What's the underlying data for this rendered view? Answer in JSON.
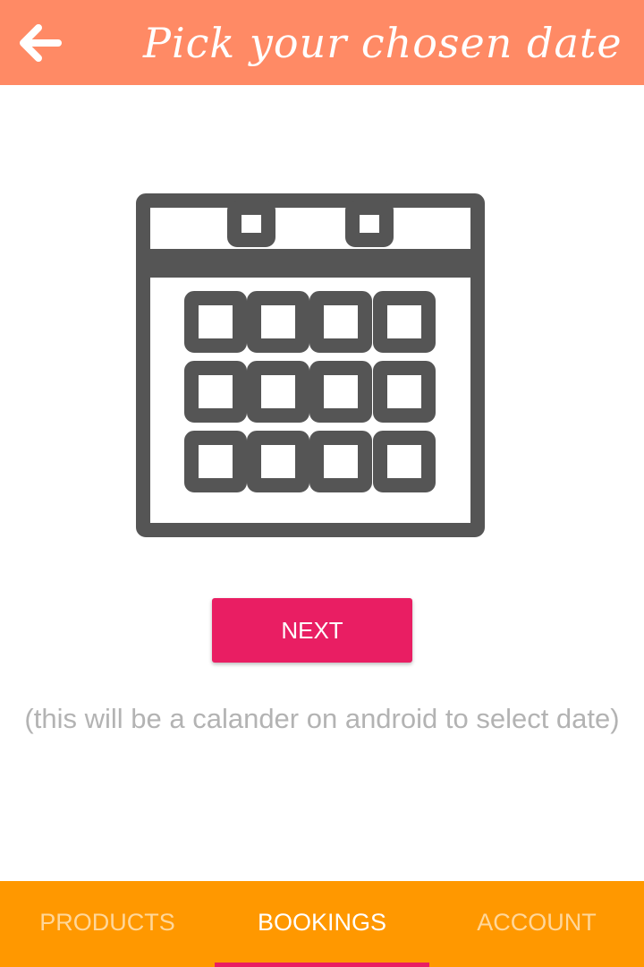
{
  "header": {
    "title": "Pick your chosen date",
    "back_icon": "arrow-left-icon"
  },
  "main": {
    "illustration_icon": "calendar-icon",
    "next_label": "NEXT",
    "hint_text": "(this will be a calander on android to select date)"
  },
  "bottom_nav": {
    "tabs": [
      {
        "label": "PRODUCTS",
        "active": false
      },
      {
        "label": "BOOKINGS",
        "active": true
      },
      {
        "label": "ACCOUNT",
        "active": false
      }
    ]
  },
  "colors": {
    "header_bg": "#ff8a65",
    "accent": "#e91e63",
    "nav_bg": "#ff9800",
    "icon_gray": "#555555",
    "hint_text": "#b3b3b3"
  }
}
